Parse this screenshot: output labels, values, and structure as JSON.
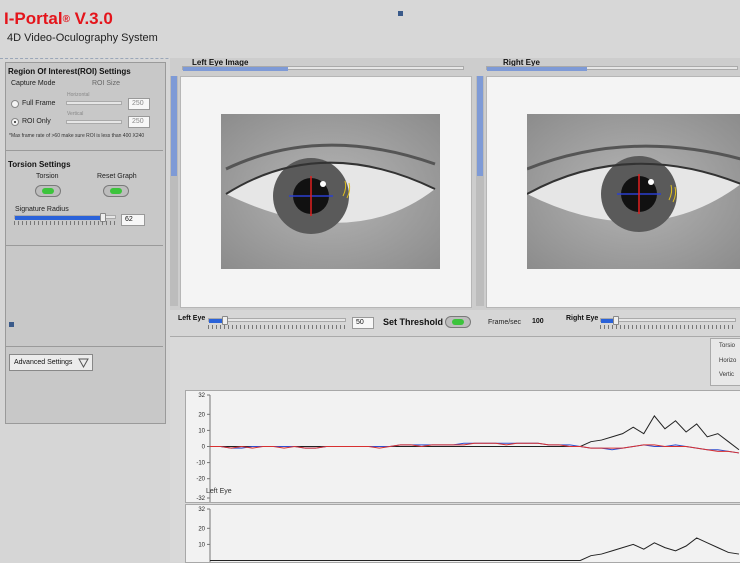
{
  "app": {
    "title": "I-Portal",
    "title_mark": "®",
    "version": "V.3.0",
    "subtitle": "4D Video-Oculography System"
  },
  "roi": {
    "heading": "Region Of Interest(ROI) Settings",
    "capture_mode_label": "Capture Mode",
    "roi_size_label": "ROI Size",
    "options": [
      "Full Frame",
      "ROI Only"
    ],
    "selected": "ROI Only",
    "horizontal_label": "Horizontal",
    "vertical_label": "Vertical",
    "horizontal_value": "250",
    "vertical_value": "250",
    "footnote": "*Max frame rate of >60 make sure ROI is less than 400 X240"
  },
  "torsion": {
    "heading": "Torsion Settings",
    "torsion_label": "Torsion",
    "reset_label": "Reset Graph",
    "radius_label": "Signature Radius",
    "radius_value": "62",
    "radius_fraction": 0.87
  },
  "advanced": {
    "label": "Advanced Settings"
  },
  "left_eye": {
    "title": "Left Eye Image",
    "threshold_label": "Left Eye",
    "threshold_value": "50",
    "threshold_fraction": 0.12
  },
  "right_eye": {
    "title": "Right Eye",
    "threshold_label": "Right Eye",
    "threshold_fraction": 0.12
  },
  "controls": {
    "set_threshold": "Set Threshold",
    "frame_label": "Frame/sec",
    "frame_value": "100"
  },
  "legend": [
    "Torsio",
    "Horizo",
    "Vertic"
  ],
  "colors": {
    "title_red": "#e4141b",
    "slider_blue": "#2a62d9",
    "led_green": "#3cc43c",
    "torsion": "#222222",
    "horizontal": "#2f4fd0",
    "vertical": "#d83030"
  },
  "chart_data": [
    {
      "type": "line",
      "title": "Left Eye",
      "ylim": [
        -32,
        32
      ],
      "yticks": [
        "32",
        "20",
        "10",
        "0",
        "-10",
        "-20",
        "-32"
      ],
      "x": [
        0,
        2,
        4,
        6,
        8,
        10,
        12,
        14,
        16,
        18,
        20,
        22,
        24,
        26,
        28,
        30,
        32,
        34,
        36,
        38,
        40,
        42,
        44,
        46,
        48,
        50,
        52,
        54,
        56,
        58,
        60,
        62,
        64,
        66,
        68,
        70,
        72,
        74,
        76,
        78,
        80,
        82,
        84,
        86,
        88,
        90,
        92,
        94,
        96,
        98,
        100
      ],
      "series": [
        {
          "name": "Torsion",
          "color": "#222222",
          "values": [
            0,
            0,
            0,
            0,
            0,
            0,
            0,
            0,
            0,
            0,
            0,
            0,
            0,
            0,
            0,
            0,
            0,
            0,
            0,
            0,
            0,
            0,
            0,
            0,
            0,
            0,
            0,
            0,
            0,
            0,
            0,
            0,
            0,
            0,
            0,
            0,
            3,
            4,
            6,
            8,
            12,
            8,
            19,
            11,
            16,
            9,
            14,
            6,
            8,
            3,
            -2
          ]
        },
        {
          "name": "Horizontal",
          "color": "#2f4fd0",
          "values": [
            0,
            0,
            -1,
            -1,
            0,
            0,
            0,
            0,
            0,
            -1,
            -1,
            0,
            0,
            0,
            0,
            0,
            0,
            0,
            1,
            1,
            1,
            1,
            1,
            1,
            2,
            2,
            2,
            2,
            2,
            2,
            2,
            2,
            1,
            1,
            1,
            0,
            -1,
            -1,
            -2,
            -1,
            0,
            1,
            0,
            0,
            1,
            0,
            -1,
            -2,
            -2,
            -3,
            -4
          ]
        },
        {
          "name": "Vertical",
          "color": "#d83030",
          "values": [
            0,
            0,
            -1,
            0,
            -1,
            0,
            0,
            -1,
            0,
            -1,
            -1,
            0,
            0,
            0,
            0,
            0,
            -1,
            0,
            1,
            1,
            0,
            1,
            1,
            1,
            1,
            2,
            2,
            2,
            1,
            2,
            2,
            2,
            1,
            1,
            0,
            0,
            -1,
            -1,
            -1,
            -1,
            0,
            1,
            1,
            0,
            0,
            0,
            -1,
            -2,
            -3,
            -3,
            -4
          ]
        }
      ]
    },
    {
      "type": "line",
      "ylim": [
        -32,
        32
      ],
      "yticks": [
        "32",
        "20",
        "10"
      ],
      "x": [
        0,
        2,
        4,
        6,
        8,
        10,
        12,
        14,
        16,
        18,
        20,
        22,
        24,
        26,
        28,
        30,
        32,
        34,
        36,
        38,
        40,
        42,
        44,
        46,
        48,
        50,
        52,
        54,
        56,
        58,
        60,
        62,
        64,
        66,
        68,
        70,
        72,
        74,
        76,
        78,
        80,
        82,
        84,
        86,
        88,
        90,
        92,
        94,
        96,
        98,
        100
      ],
      "series": [
        {
          "name": "Torsion",
          "color": "#222222",
          "values": [
            0,
            0,
            0,
            0,
            0,
            0,
            0,
            0,
            0,
            0,
            0,
            0,
            0,
            0,
            0,
            0,
            0,
            0,
            0,
            0,
            0,
            0,
            0,
            0,
            0,
            0,
            0,
            0,
            0,
            0,
            0,
            0,
            0,
            0,
            0,
            0,
            3,
            4,
            6,
            8,
            10,
            7,
            11,
            8,
            6,
            9,
            14,
            11,
            8,
            5,
            4
          ]
        }
      ]
    }
  ]
}
